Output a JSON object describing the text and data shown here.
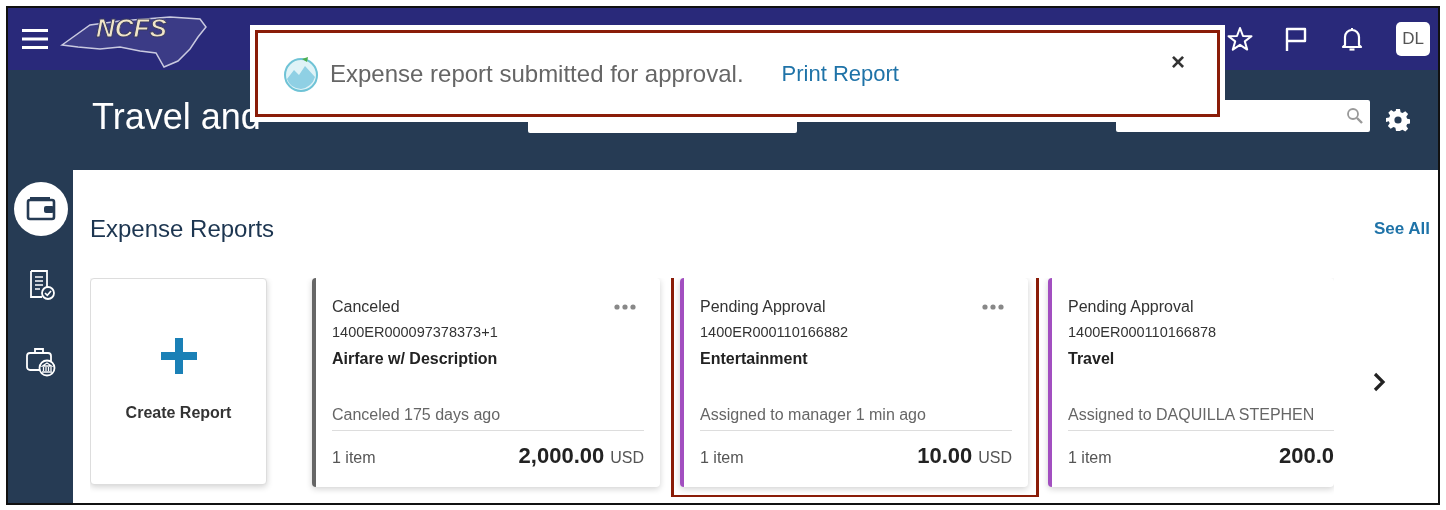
{
  "header": {
    "logo": "NCFS",
    "title": "Travel and",
    "avatar": "DL"
  },
  "sidebar": {
    "items": [
      {
        "selected": true
      },
      {
        "selected": false
      },
      {
        "selected": false
      }
    ]
  },
  "notification": {
    "message": "Expense report submitted for approval.",
    "link": "Print Report",
    "close": "×",
    "highlighted": true
  },
  "section": {
    "title": "Expense Reports",
    "see_all": "See All",
    "create_label": "Create Report",
    "reports": [
      {
        "status": "Canceled",
        "number": "1400ER000097378373+1",
        "name": "Airfare w/ Description",
        "activity": "Canceled 175 days ago",
        "items": "1 item",
        "amount": "2,000.00",
        "currency": "USD",
        "color": "#666666",
        "menu": true,
        "highlighted": false
      },
      {
        "status": "Pending Approval",
        "number": "1400ER000110166882",
        "name": "Entertainment",
        "activity": "Assigned to manager 1 min ago",
        "items": "1 item",
        "amount": "10.00",
        "currency": "USD",
        "color": "#a24fc0",
        "menu": true,
        "highlighted": true
      },
      {
        "status": "Pending Approval",
        "number": "1400ER000110166878",
        "name": "Travel",
        "activity": "Assigned to DAQUILLA STEPHEN",
        "items": "1 item",
        "amount": "200.0",
        "color": "#a24fc0",
        "menu": false,
        "highlighted": false
      }
    ]
  }
}
